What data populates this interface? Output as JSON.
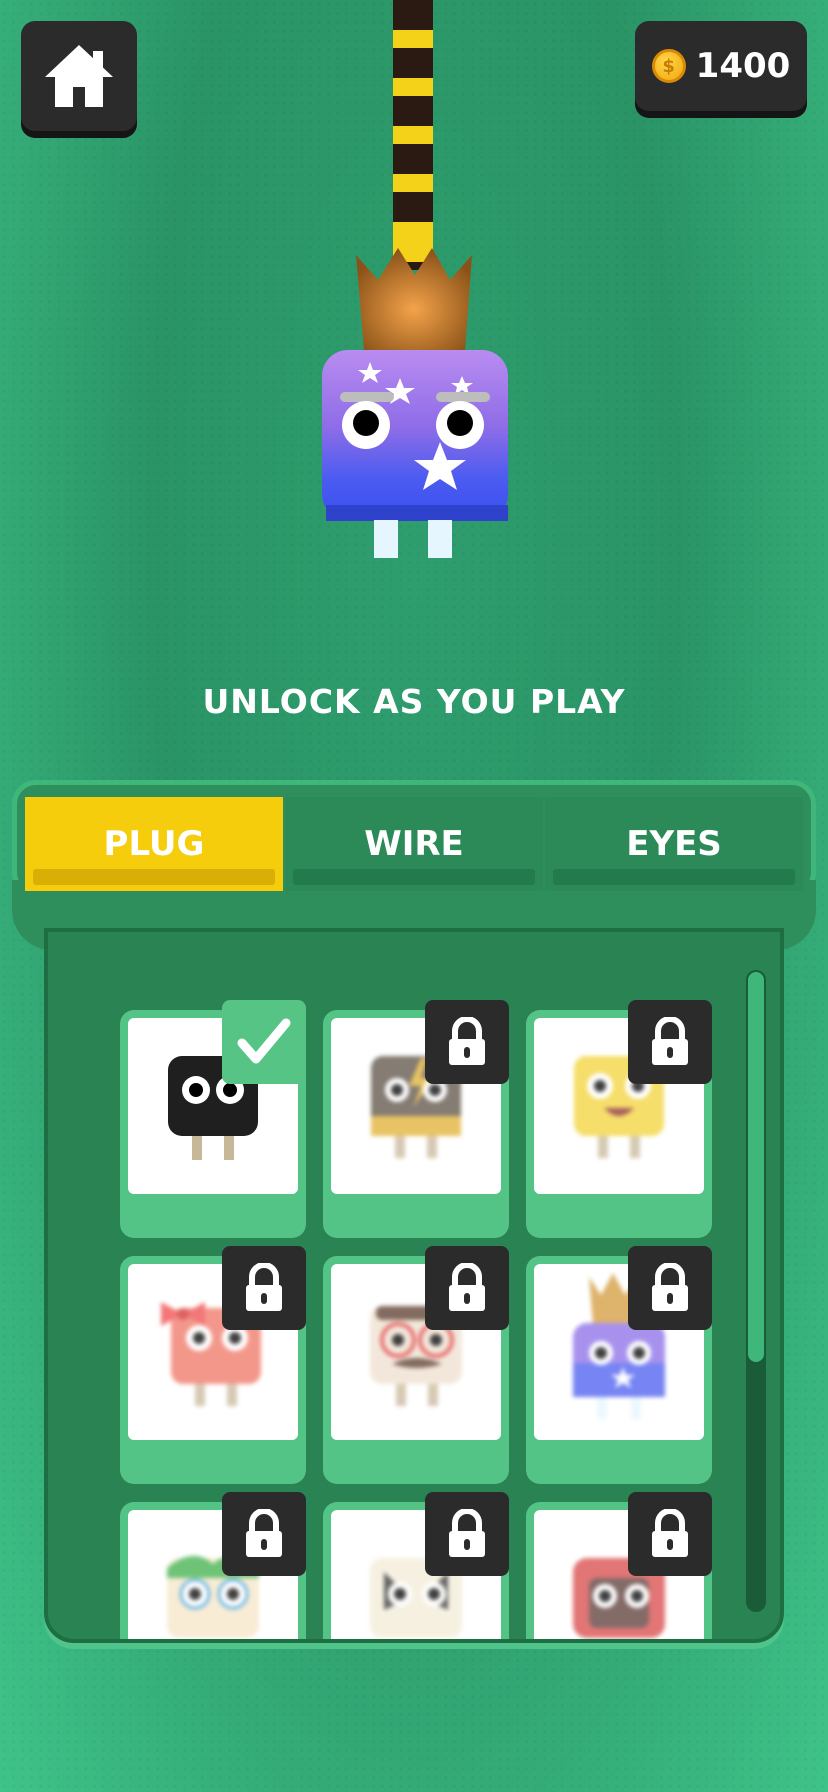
{
  "currency": {
    "amount": "1400",
    "icon": "coin-icon"
  },
  "home": {
    "icon": "home-icon"
  },
  "unlock_text": "UNLOCK AS YOU PLAY",
  "tabs": [
    {
      "label": "PLUG",
      "active": true
    },
    {
      "label": "WIRE",
      "active": false
    },
    {
      "label": "EYES",
      "active": false
    }
  ],
  "colors": {
    "background": "#2a9466",
    "active_tab": "#f5cd0c",
    "panel": "#2a8353",
    "card": "#53c386",
    "lock_bg": "#2b2b2b"
  },
  "items": [
    {
      "name": "black-plug",
      "status": "selected"
    },
    {
      "name": "lightning-plug",
      "status": "locked"
    },
    {
      "name": "yellow-smile-plug",
      "status": "locked"
    },
    {
      "name": "bow-plug",
      "status": "locked"
    },
    {
      "name": "glasses-mustache-plug",
      "status": "locked"
    },
    {
      "name": "crown-star-plug",
      "status": "locked"
    },
    {
      "name": "clown-plug",
      "status": "locked"
    },
    {
      "name": "rocker-plug",
      "status": "locked"
    },
    {
      "name": "red-hood-plug",
      "status": "locked"
    }
  ]
}
